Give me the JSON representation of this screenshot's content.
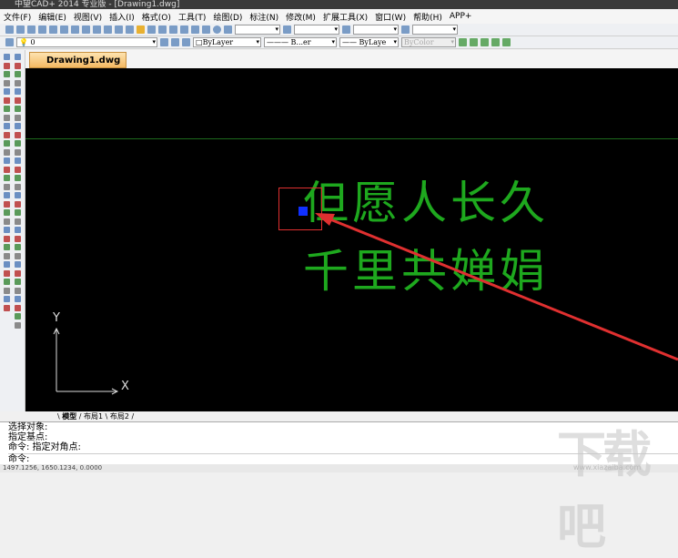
{
  "title": "中望CAD+ 2014 专业版 - [Drawing1.dwg]",
  "menu": [
    "文件(F)",
    "编辑(E)",
    "视图(V)",
    "插入(I)",
    "格式(O)",
    "工具(T)",
    "绘图(D)",
    "标注(N)",
    "修改(M)",
    "扩展工具(X)",
    "窗口(W)",
    "帮助(H)",
    "APP+"
  ],
  "layer": {
    "current": "0",
    "color": "ByLayer",
    "linetype": "B...er",
    "lineweight": "ByLaye",
    "plotstyle": "ByColor"
  },
  "doc_tab": "Drawing1.dwg",
  "canvas": {
    "line1": "但愿人长久",
    "line2": "千里共婵娟",
    "ucs_x": "X",
    "ucs_y": "Y"
  },
  "layout_tabs": [
    "模型",
    "布局1",
    "布局2"
  ],
  "command_history": [
    "选择对象:",
    "指定基点:",
    "命令: 指定对角点:"
  ],
  "command_prompt": "命令:",
  "status_coords": "1497.1256, 1650.1234, 0.0000",
  "watermark": "下载吧",
  "watermark_url": "www.xiazaiba.com",
  "colors": {
    "text": "#1ea81e",
    "highlight": "#e03030",
    "grip": "#1030ff"
  }
}
